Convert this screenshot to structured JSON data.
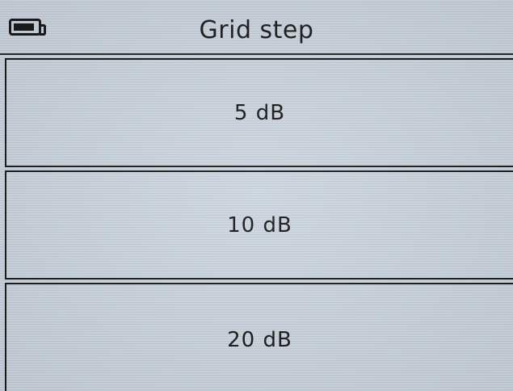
{
  "header": {
    "title": "Grid step",
    "battery_icon": "battery-icon"
  },
  "options": [
    {
      "label": "5 dB"
    },
    {
      "label": "10 dB"
    },
    {
      "label": "20 dB"
    }
  ],
  "colors": {
    "background": "#c9d3dc",
    "foreground": "#1a1a1a"
  }
}
